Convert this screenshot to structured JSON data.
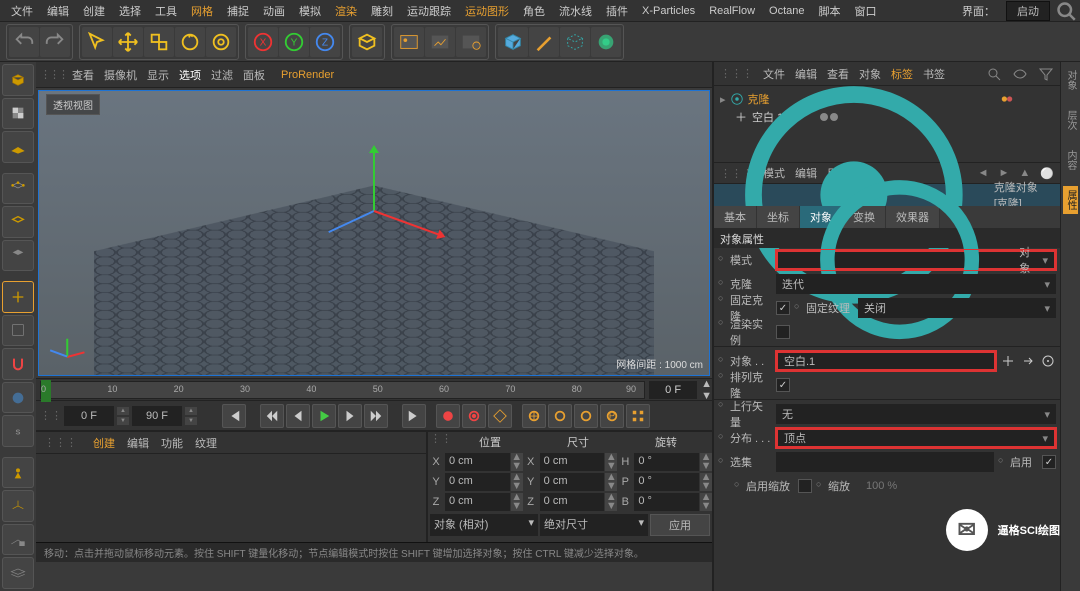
{
  "menu": {
    "items": [
      "文件",
      "编辑",
      "创建",
      "选择",
      "工具",
      "网格",
      "捕捉",
      "动画",
      "模拟",
      "渲染",
      "雕刻",
      "运动跟踪",
      "运动图形",
      "角色",
      "流水线",
      "插件",
      "X-Particles",
      "RealFlow",
      "Octane",
      "脚本",
      "窗口"
    ],
    "highlight_idx": [
      5,
      9,
      12
    ],
    "layout_label": "界面：",
    "layout_value": "启动"
  },
  "vp_menu": {
    "items": [
      "查看",
      "摄像机",
      "显示",
      "选项",
      "过滤",
      "面板"
    ],
    "highlight_idx": [
      3
    ],
    "prorender": "ProRender"
  },
  "vp_title": "透视视图",
  "grid_info": "网格间距 : 1000 cm",
  "timeline": {
    "start": "0",
    "end": "90",
    "ticks": [
      0,
      10,
      20,
      30,
      40,
      50,
      60,
      70,
      80,
      90
    ],
    "endfield": "0 F",
    "f1": "0 F",
    "f2": "90 F"
  },
  "mat_menu": [
    "创建",
    "编辑",
    "功能",
    "纹理"
  ],
  "coord": {
    "heads": [
      "位置",
      "尺寸",
      "旋转"
    ],
    "rows": [
      {
        "l": "X",
        "p": "0 cm",
        "s": "0 cm",
        "r": "0 °"
      },
      {
        "l": "Y",
        "p": "0 cm",
        "s": "0 cm",
        "r": "0 °"
      },
      {
        "l": "Z",
        "p": "0 cm",
        "s": "0 cm",
        "r": "0 °"
      }
    ],
    "dd1": "对象 (相对)",
    "dd2": "绝对尺寸",
    "apply": "应用",
    "sub": [
      "X",
      "Y",
      "Z"
    ],
    "sub2": [
      "H",
      "P",
      "B"
    ]
  },
  "status": "移动：点击并拖动鼠标移动元素。按住 SHIFT 键量化移动；节点编辑模式时按住 SHIFT 键增加选择对象；按住 CTRL 键减少选择对象。",
  "obj_bar": {
    "items": [
      "文件",
      "编辑",
      "查看",
      "对象",
      "标签",
      "书签"
    ],
    "hl_idx": [
      4
    ]
  },
  "tree": [
    {
      "name": "克隆",
      "sel": true,
      "color": "#3aa"
    },
    {
      "name": "空白.1",
      "sel": false,
      "color": "#ddd"
    }
  ],
  "attr_bar": [
    "模式",
    "编辑",
    "用户数据"
  ],
  "attr_title": "克隆对象 [克隆]",
  "tabs": [
    "基本",
    "坐标",
    "对象",
    "变换",
    "效果器"
  ],
  "tabs_active": 2,
  "section": "对象属性",
  "props": {
    "mode_l": "模式",
    "mode_v": "对象",
    "clone_l": "克隆",
    "clone_v": "迭代",
    "fixc_l": "固定克隆",
    "fixt_l": "固定纹理",
    "fixt_v": "关闭",
    "inst_l": "渲染实例",
    "obj_l": "对象 . .",
    "obj_v": "空白.1",
    "arr_l": "排列克隆",
    "up_l": "上行矢量",
    "up_v": "无",
    "dist_l": "分布 . . .",
    "dist_v": "顶点",
    "sel_l": "选集",
    "sel_v": "",
    "enable_l": "启用",
    "escale_l": "启用缩放",
    "scale_l": "缩放",
    "scale_v": "100 %"
  },
  "watermark": "逼格SCI绘图",
  "rslim": [
    "对象",
    "层次",
    "内容",
    "属性"
  ]
}
